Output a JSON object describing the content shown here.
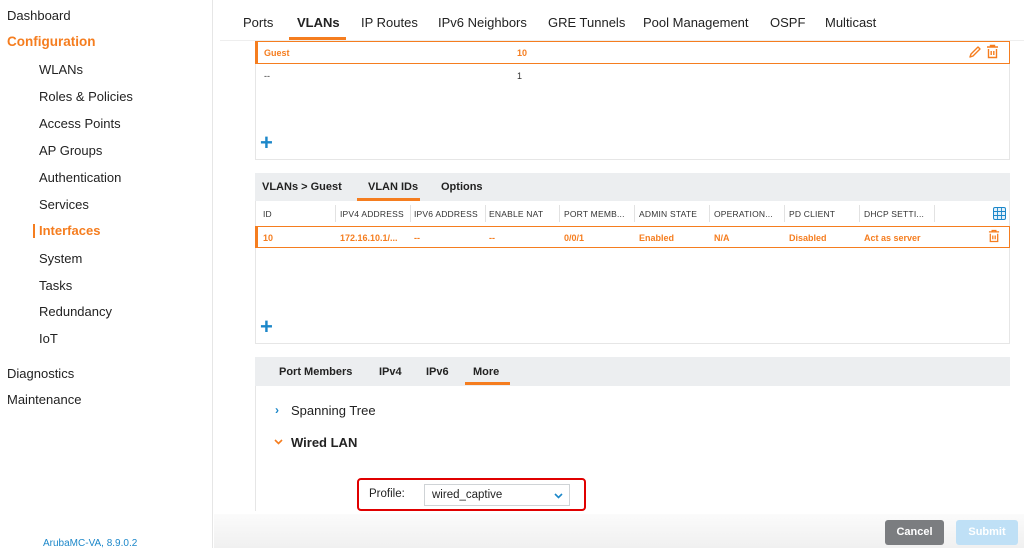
{
  "sidebar": {
    "top_items": [
      {
        "label": "Dashboard",
        "active": false
      },
      {
        "label": "Configuration",
        "active": true
      }
    ],
    "config_items": [
      {
        "label": "WLANs"
      },
      {
        "label": "Roles & Policies"
      },
      {
        "label": "Access Points"
      },
      {
        "label": "AP Groups"
      },
      {
        "label": "Authentication"
      },
      {
        "label": "Services"
      },
      {
        "label": "Interfaces",
        "active": true
      },
      {
        "label": "System"
      },
      {
        "label": "Tasks"
      },
      {
        "label": "Redundancy"
      },
      {
        "label": "IoT"
      }
    ],
    "bottom_items": [
      {
        "label": "Diagnostics"
      },
      {
        "label": "Maintenance"
      }
    ],
    "version": "ArubaMC-VA, 8.9.0.2"
  },
  "tabs": [
    {
      "label": "Ports"
    },
    {
      "label": "VLANs",
      "active": true
    },
    {
      "label": "IP Routes"
    },
    {
      "label": "IPv6 Neighbors"
    },
    {
      "label": "GRE Tunnels"
    },
    {
      "label": "Pool Management"
    },
    {
      "label": "OSPF"
    },
    {
      "label": "Multicast"
    }
  ],
  "vlan_list": {
    "rows": [
      {
        "name": "Guest",
        "id": "10",
        "selected": true
      },
      {
        "name": "--",
        "id": "1",
        "selected": false
      }
    ],
    "add_icon": "plus-icon",
    "edit_icon": "pencil-icon",
    "delete_icon": "trash-icon"
  },
  "vlan_detail": {
    "breadcrumb": "VLANs > Guest",
    "tabs": [
      {
        "label": "VLAN IDs",
        "active": true
      },
      {
        "label": "Options"
      }
    ],
    "columns": [
      "ID",
      "IPV4 ADDRESS",
      "IPV6 ADDRESS",
      "ENABLE NAT",
      "PORT MEMB...",
      "ADMIN STATE",
      "OPERATION...",
      "PD CLIENT",
      "DHCP SETTI..."
    ],
    "rows": [
      {
        "cells": [
          "10",
          "172.16.10.1/...",
          "--",
          "--",
          "0/0/1",
          "Enabled",
          "N/A",
          "Disabled",
          "Act as server"
        ],
        "selected": true
      }
    ],
    "column_chooser_icon": "grid-icon"
  },
  "vlan_id_detail": {
    "tabs": [
      {
        "label": "Port Members"
      },
      {
        "label": "IPv4"
      },
      {
        "label": "IPv6"
      },
      {
        "label": "More",
        "active": true
      }
    ],
    "sections": [
      {
        "label": "Spanning Tree",
        "expanded": false
      },
      {
        "label": "Wired LAN",
        "expanded": true
      }
    ],
    "profile": {
      "label": "Profile:",
      "value": "wired_captive"
    }
  },
  "footer": {
    "cancel_label": "Cancel",
    "submit_label": "Submit"
  },
  "colors": {
    "accent": "#f57d1f",
    "link": "#1c87c9",
    "highlight": "#e00000"
  }
}
